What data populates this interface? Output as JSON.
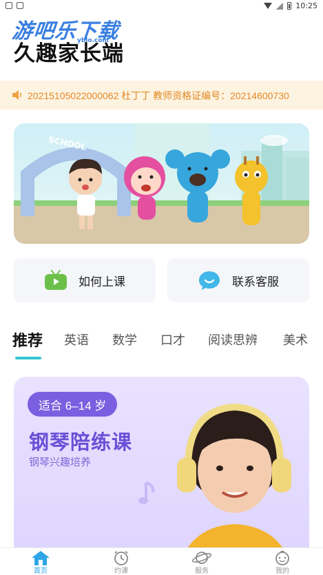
{
  "status_bar": {
    "time": "10:25"
  },
  "watermark": {
    "text": "游吧乐下载",
    "sub": "yblo.com"
  },
  "app": {
    "title": "久趣家长端"
  },
  "notice": {
    "text": "20215105022000062     杜丁丁 教师资格证编号：20214600730"
  },
  "banner": {
    "sign_text": "SCHOOL"
  },
  "quick_actions": [
    {
      "label": "如何上课",
      "icon": "tv-play-icon"
    },
    {
      "label": "联系客服",
      "icon": "chat-bubble-icon"
    }
  ],
  "tabs": [
    {
      "label": "推荐",
      "active": true
    },
    {
      "label": "英语"
    },
    {
      "label": "数学"
    },
    {
      "label": "口才"
    },
    {
      "label": "阅读思辨"
    },
    {
      "label": "美术"
    }
  ],
  "course_card": {
    "age_label": "适合 6–14 岁",
    "title": "钢琴陪练课",
    "subtitle": "钢琴兴趣培养"
  },
  "bottom_nav": [
    {
      "label": "首页",
      "icon": "home-icon",
      "active": true
    },
    {
      "label": "约课",
      "icon": "alarm-clock-icon"
    },
    {
      "label": "服务",
      "icon": "planet-icon"
    },
    {
      "label": "我的",
      "icon": "baby-face-icon"
    }
  ],
  "colors": {
    "accent": "#34c5d5",
    "notice_text": "#e28a26",
    "purple": "#6a4fd6",
    "nav_active": "#2ea6e8"
  }
}
